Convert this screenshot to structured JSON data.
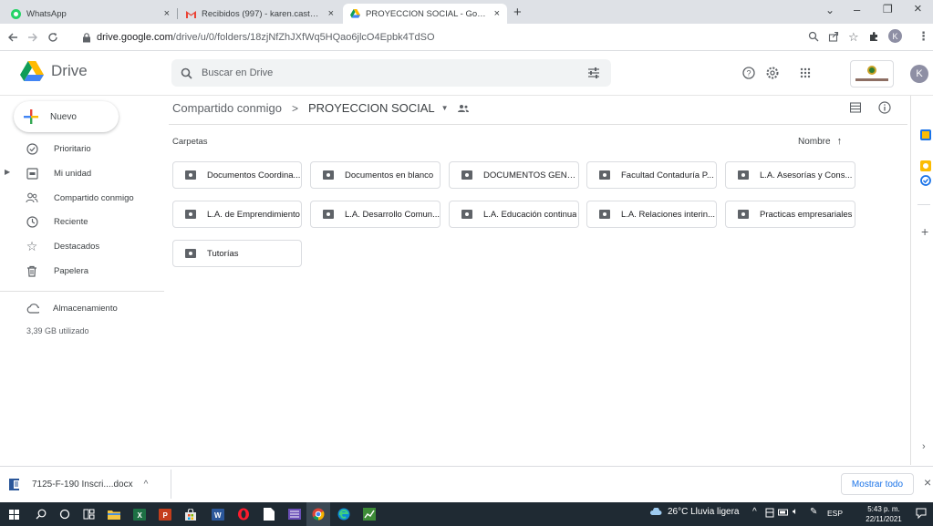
{
  "tabs": [
    {
      "title": "WhatsApp",
      "close": "×",
      "icon": "whatsapp-icon"
    },
    {
      "title": "Recibidos (997) - karen.castaned",
      "close": "×",
      "icon": "gmail-icon"
    },
    {
      "title": "PROYECCION SOCIAL - Google D",
      "close": "×",
      "icon": "drive-icon"
    }
  ],
  "new_tab": "+",
  "window_controls": {
    "dropdown": "⌄",
    "minimize": "–",
    "maximize": "❐",
    "close": "×"
  },
  "address": {
    "domain": "drive.google.com",
    "path": "/drive/u/0/folders/18zjNfZhJXfWq5HQao6jlcO4Epbk4TdSO"
  },
  "profile_initial": "K",
  "app": {
    "name": "Drive"
  },
  "search": {
    "placeholder": "Buscar en Drive"
  },
  "new_button": "Nuevo",
  "sidebar": {
    "items": [
      {
        "label": "Prioritario",
        "icon": "check-circle-icon"
      },
      {
        "label": "Mi unidad",
        "icon": "my-drive-icon"
      },
      {
        "label": "Compartido conmigo",
        "icon": "shared-icon"
      },
      {
        "label": "Reciente",
        "icon": "clock-icon"
      },
      {
        "label": "Destacados",
        "icon": "star-icon"
      },
      {
        "label": "Papelera",
        "icon": "trash-icon"
      }
    ],
    "storage_label": "Almacenamiento",
    "storage_used": "3,39 GB utilizado"
  },
  "breadcrumb": {
    "parent": "Compartido conmigo",
    "separator": ">",
    "current": "PROYECCION SOCIAL"
  },
  "section_label": "Carpetas",
  "sort_label": "Nombre",
  "sort_arrow": "↑",
  "folders": [
    "Documentos Coordina...",
    "Documentos en blanco",
    "DOCUMENTOS GENER...",
    "Facultad Contaduría P...",
    "L.A. Asesorías y Cons...",
    "L.A. de Emprendimiento",
    "L.A. Desarrollo Comun...",
    "L.A. Educación continua",
    "L.A. Relaciones interin...",
    "Practicas empresariales",
    "Tutorías"
  ],
  "download": {
    "filename": "7125-F-190 Inscri....docx",
    "show_all": "Mostrar todo",
    "chevron": "^",
    "close": "×"
  },
  "taskbar": {
    "weather": "26°C  Lluvia ligera",
    "lang": "ESP",
    "time": "5:43 p. m.",
    "date": "22/11/2021"
  },
  "colors": {
    "accent": "#1a73e8",
    "taskbar": "#1f2a33",
    "tabstrip": "#dee1e6"
  }
}
